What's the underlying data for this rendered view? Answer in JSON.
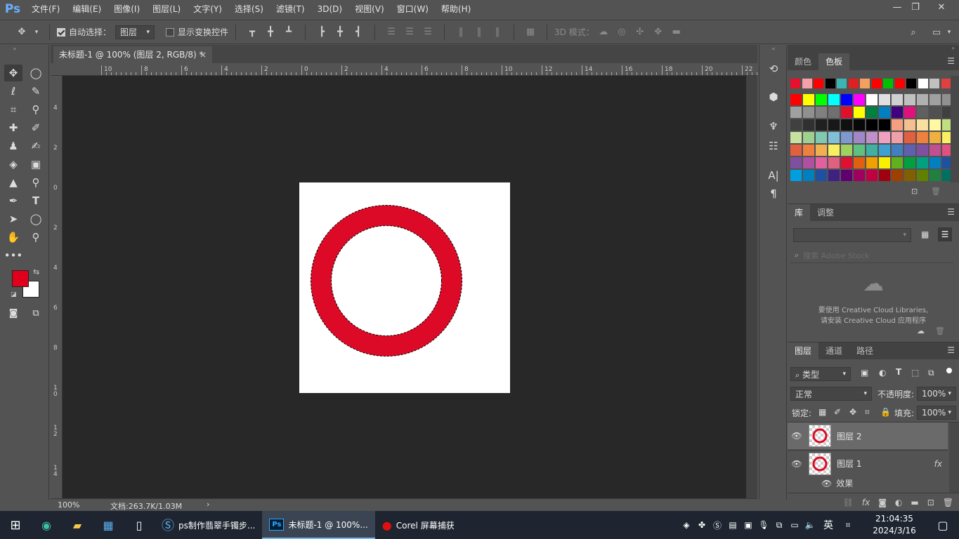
{
  "app": {
    "logo": "Ps"
  },
  "menu": [
    "文件(F)",
    "编辑(E)",
    "图像(I)",
    "图层(L)",
    "文字(Y)",
    "选择(S)",
    "滤镜(T)",
    "3D(D)",
    "视图(V)",
    "窗口(W)",
    "帮助(H)"
  ],
  "options": {
    "auto_select_label": "自动选择：",
    "auto_select_value": "图层",
    "transform_label": "显示变换控件",
    "mode_3d_label": "3D 模式："
  },
  "document": {
    "tab_title": "未标题-1 @ 100% (图层 2, RGB/8) *",
    "close": "×"
  },
  "ruler": {
    "h": [
      "10",
      "8",
      "6",
      "4",
      "2",
      "0",
      "2",
      "4",
      "6",
      "8",
      "10",
      "12",
      "14",
      "16",
      "18",
      "20",
      "22"
    ],
    "v": [
      "4",
      "2",
      "0",
      "2",
      "4",
      "6",
      "8",
      "1\n0",
      "1\n2",
      "1\n4"
    ]
  },
  "status": {
    "zoom": "100%",
    "doc_info": "文档:263.7K/1.03M",
    "arrow": "›"
  },
  "colors": {
    "foreground": "#e0001c",
    "background": "#ffffff",
    "ring": "#dc0a26"
  },
  "color_panel": {
    "tabs": [
      "颜色",
      "色板"
    ],
    "active": 1
  },
  "library_panel": {
    "tabs": [
      "库",
      "调整"
    ],
    "search_placeholder": "搜索 Adobe Stock",
    "msg_line1": "要使用 Creative Cloud Libraries,",
    "msg_line2": "请安装 Creative Cloud 应用程序"
  },
  "layers_panel": {
    "tabs": [
      "图层",
      "通道",
      "路径"
    ],
    "filter_type": "类型",
    "blend_mode": "正常",
    "opacity_label": "不透明度:",
    "opacity_value": "100%",
    "lock_label": "锁定:",
    "fill_label": "填充:",
    "fill_value": "100%",
    "layers": [
      {
        "name": "图层 2",
        "selected": true
      },
      {
        "name": "图层 1",
        "selected": false,
        "fx": "fx"
      }
    ],
    "effects_label": "效果"
  },
  "taskbar": {
    "apps": [
      {
        "label": "ps制作翡翠手镯步...",
        "active": false
      },
      {
        "label": "未标题-1 @ 100%...",
        "active": true
      },
      {
        "label": "Corel 屏幕捕获",
        "active": false
      }
    ],
    "ime": "英",
    "time": "21:04:35",
    "date": "2024/3/16"
  }
}
